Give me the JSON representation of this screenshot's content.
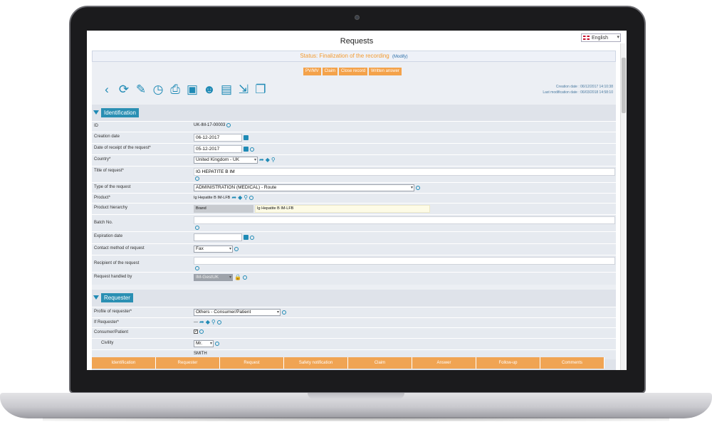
{
  "app": {
    "title": "Requests",
    "language": "English"
  },
  "status": {
    "text": "Status: Finalization of the recording",
    "modify": "(Modify)"
  },
  "actions": [
    "PV/MV",
    "Claim",
    "Close record",
    "Written answer"
  ],
  "dates": {
    "creation": "Creation date : 06/12/2017 14:10:38",
    "modification": "Last modification date : 06/03/2018 14:58:10"
  },
  "toolbar": [
    "back-icon",
    "refresh-icon",
    "paperclip-icon",
    "clock-icon",
    "print-icon",
    "save-icon",
    "user-icon",
    "document-icon",
    "export-icon",
    "copy-icon"
  ],
  "identification": {
    "title": "Identification",
    "fields": {
      "id_label": "ID",
      "id_value": "UK-IM-17-00003",
      "creation_label": "Creation date",
      "creation_value": "06-12-2017",
      "receipt_label": "Date of receipt of the request*",
      "receipt_value": "05-12-2017",
      "country_label": "Country*",
      "country_value": "United Kingdom - UK",
      "title_label": "Title of request*",
      "title_value": "IG HEPATITE B IM",
      "type_label": "Type of the request",
      "type_value": "ADMINISTRATION (MEDICAL) - Route",
      "product_label": "Product*",
      "product_value": "Ig Hepatite B IM-LFB",
      "hierarchy_label": "Product hierarchy",
      "hierarchy_brand": "Brand",
      "hierarchy_value": "Ig Hepatite B IM-LFB",
      "batch_label": "Batch No.",
      "expiration_label": "Expiration date",
      "contact_label": "Contact method of request",
      "contact_value": "Fax",
      "recipient_label": "Recipient of the request",
      "handled_label": "Request handled by",
      "handled_value": "IM-GestUK"
    }
  },
  "requester": {
    "title": "Requester",
    "fields": {
      "profile_label": "Profile of requester*",
      "profile_value": "Others - Consumer/Patient",
      "if_label": "If Requester*",
      "if_value": "---",
      "consumer_label": "Consumer/Patient",
      "civility_label": "Civility",
      "civility_value": "Mr.",
      "surname_value": "SMITH"
    }
  },
  "tabs": [
    "Identification",
    "Requester",
    "Request",
    "Safety notification",
    "Claim",
    "Answer",
    "Follow-up",
    "Comments"
  ],
  "colors": {
    "accent": "#1f8ab5",
    "orange": "#f4a24a",
    "status": "#f39a2e"
  }
}
